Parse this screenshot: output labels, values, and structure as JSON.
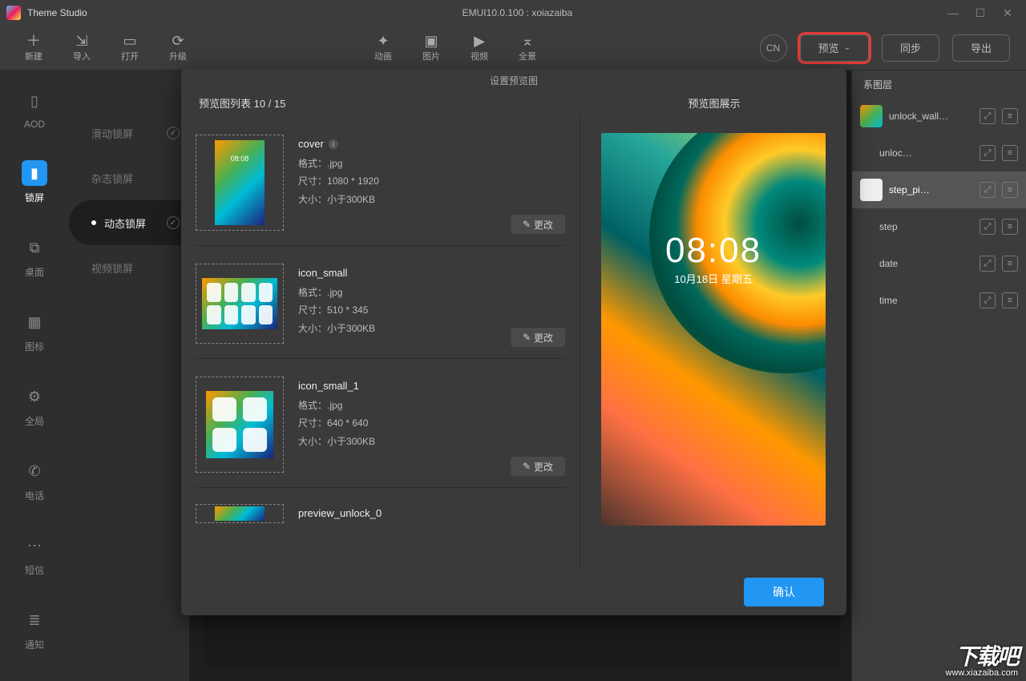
{
  "titlebar": {
    "app": "Theme Studio",
    "center": "EMUI10.0.100 : xoiazaiba"
  },
  "toolbar": {
    "new": "新建",
    "import": "导入",
    "open": "打开",
    "upgrade": "升级",
    "anim": "动画",
    "image": "图片",
    "video": "视频",
    "panorama": "全景",
    "lang": "CN",
    "preview": "预览",
    "sync": "同步",
    "export": "导出"
  },
  "leftbar": {
    "aod": "AOD",
    "lock": "锁屏",
    "desktop": "桌面",
    "icons": "图标",
    "global": "全局",
    "phone": "电话",
    "sms": "短信",
    "notify": "通知"
  },
  "subnav": {
    "slide": "滑动锁屏",
    "magazine": "杂志锁屏",
    "dynamic": "动态锁屏",
    "video": "视频锁屏"
  },
  "inspector": {
    "head": "系图层",
    "layers": [
      "unlock_wall…",
      "unloc…",
      "step_pi…",
      "step",
      "date",
      "time"
    ]
  },
  "modal": {
    "title": "设置预览图",
    "list_head": "预览图列表 10 / 15",
    "show_head": "预览图展示",
    "change": "更改",
    "confirm": "确认",
    "fmt_label": "格式：",
    "dim_label": "尺寸：",
    "size_label": "大小：",
    "items": [
      {
        "name": "cover",
        "fmt": ".jpg",
        "dim": "1080 * 1920",
        "size": "小于300KB",
        "info": true
      },
      {
        "name": "icon_small",
        "fmt": ".jpg",
        "dim": "510 * 345",
        "size": "小于300KB"
      },
      {
        "name": "icon_small_1",
        "fmt": ".jpg",
        "dim": "640 * 640",
        "size": "小于300KB"
      },
      {
        "name": "preview_unlock_0"
      }
    ],
    "phone": {
      "time": "08:08",
      "date": "10月18日 星期五"
    }
  },
  "watermark": {
    "big": "下载吧",
    "url": "www.xiazaiba.com"
  }
}
